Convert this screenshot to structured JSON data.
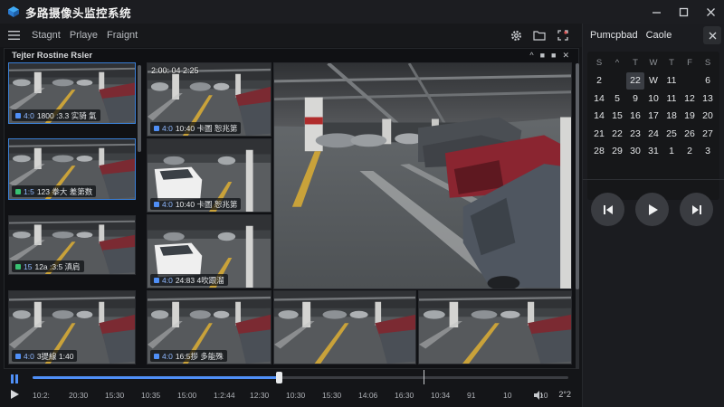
{
  "app": {
    "title": "多路摄像头监控系统",
    "accent": "#3a7fd5"
  },
  "window_controls": [
    "minimize-icon",
    "maximize-icon",
    "close-icon"
  ],
  "toolbar": {
    "menu": [
      "Stagnt",
      "Prlaye",
      "Fraignt"
    ],
    "icons": [
      "settings-icon",
      "folder-icon",
      "fullscreen-icon"
    ]
  },
  "panel": {
    "title": "Tejter Rostine Rsler",
    "controls": [
      "^",
      "■",
      "■",
      "✕"
    ]
  },
  "cameras": {
    "left": [
      {
        "id": "4:0",
        "text": "1800 :3.3 实骑 氣",
        "status": "#4f8ff7"
      },
      {
        "id": "1:5",
        "text": "123 拳大 差第数",
        "status": "#38c172"
      },
      {
        "id": "15",
        "text": "12a :3:5 滇肩",
        "status": "#38c172"
      },
      {
        "id": "4:0",
        "text": "3提線 1:40",
        "status": "#4f8ff7"
      }
    ],
    "mid": [
      {
        "timestamp": "2:00: 04 2:25",
        "id": "4:0",
        "text": "10:40 卡圖 恕兆第"
      },
      {
        "id": "4:0",
        "text": "10:40 卡圖 恕兆第"
      },
      {
        "id": "4:0",
        "text": "24:83 4吹跟溜"
      },
      {
        "id": "4:0",
        "text": "16:5拶 多能殊"
      }
    ]
  },
  "timeline": {
    "progress": 0.46,
    "marker": 0.73,
    "ticks": [
      "10:2:",
      "20:30",
      "15:30",
      "10:35",
      "15:00",
      "1:2:44",
      "12:30",
      "10:30",
      "15:30",
      "14:06",
      "16:30",
      "10:34",
      "91",
      "10",
      "10"
    ],
    "right_label": "2°2"
  },
  "side": {
    "tabs": [
      "Pumcpbad",
      "Caole"
    ],
    "calendar": {
      "headers": [
        "S",
        "^",
        "T",
        "W",
        "T",
        "F",
        "S"
      ],
      "rows": [
        [
          "2",
          "",
          "22",
          "W",
          "11",
          "",
          "6"
        ],
        [
          "14",
          "5",
          "9",
          "10",
          "11",
          "12",
          "13"
        ],
        [
          "14",
          "15",
          "16",
          "17",
          "18",
          "19",
          "20"
        ],
        [
          "21",
          "22",
          "23",
          "24",
          "25",
          "26",
          "27"
        ],
        [
          "28",
          "29",
          "30",
          "31",
          "1",
          "2",
          "3"
        ]
      ]
    },
    "media": [
      "previous-icon",
      "play-icon",
      "next-icon"
    ]
  }
}
